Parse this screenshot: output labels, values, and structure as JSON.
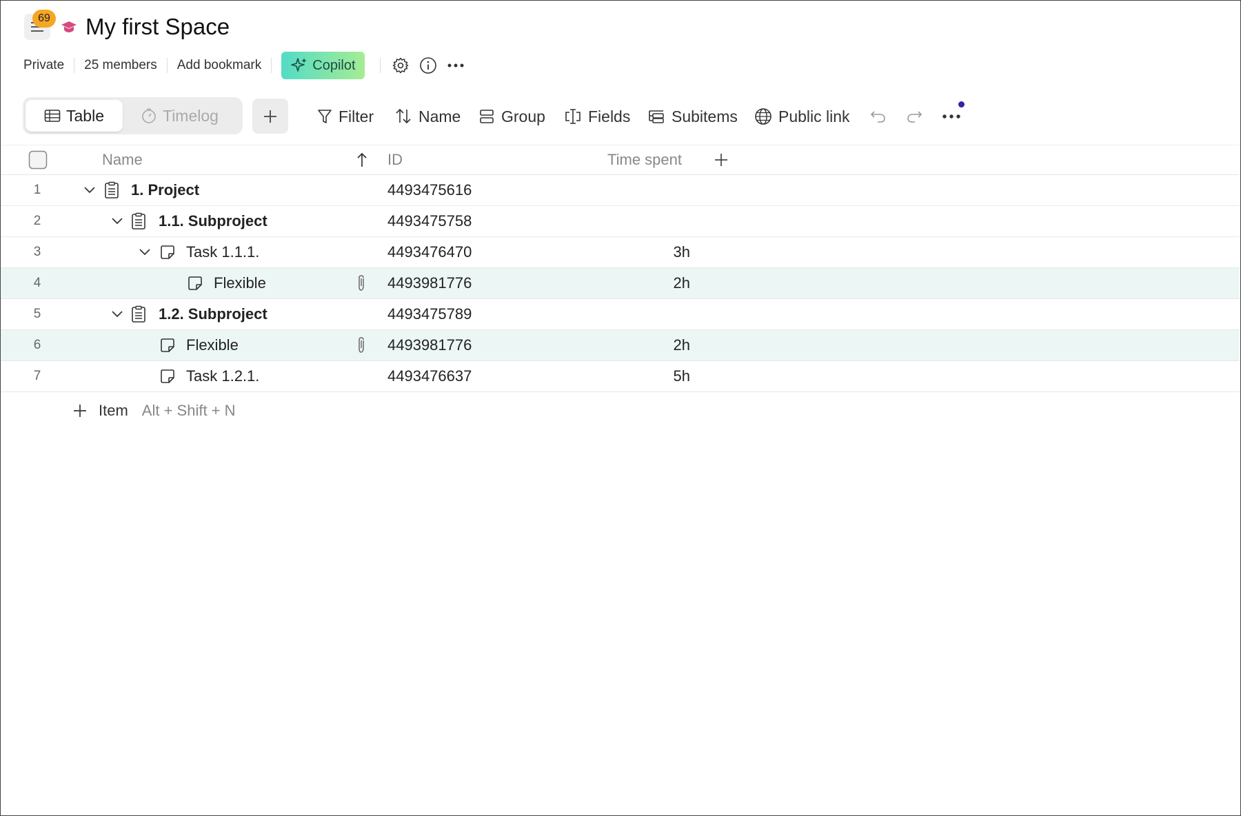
{
  "header": {
    "notification_count": "69",
    "title": "My first Space",
    "privacy": "Private",
    "members": "25 members",
    "bookmark": "Add bookmark",
    "copilot": "Copilot"
  },
  "toolbar": {
    "tabs": [
      {
        "label": "Table"
      },
      {
        "label": "Timelog"
      }
    ],
    "filter": "Filter",
    "sort": "Name",
    "group": "Group",
    "fields": "Fields",
    "subitems": "Subitems",
    "public_link": "Public link"
  },
  "table": {
    "columns": {
      "name": "Name",
      "id": "ID",
      "time": "Time spent"
    },
    "rows": [
      {
        "num": "1",
        "name": "1. Project",
        "id": "4493475616",
        "time": ""
      },
      {
        "num": "2",
        "name": "1.1. Subproject",
        "id": "4493475758",
        "time": ""
      },
      {
        "num": "3",
        "name": "Task 1.1.1.",
        "id": "4493476470",
        "time": "3h"
      },
      {
        "num": "4",
        "name": "Flexible",
        "id": "4493981776",
        "time": "2h"
      },
      {
        "num": "5",
        "name": "1.2. Subproject",
        "id": "4493475789",
        "time": ""
      },
      {
        "num": "6",
        "name": "Flexible",
        "id": "4493981776",
        "time": "2h"
      },
      {
        "num": "7",
        "name": "Task 1.2.1.",
        "id": "4493476637",
        "time": "5h"
      }
    ]
  },
  "add_item": {
    "label": "Item",
    "shortcut": "Alt + Shift + N"
  }
}
